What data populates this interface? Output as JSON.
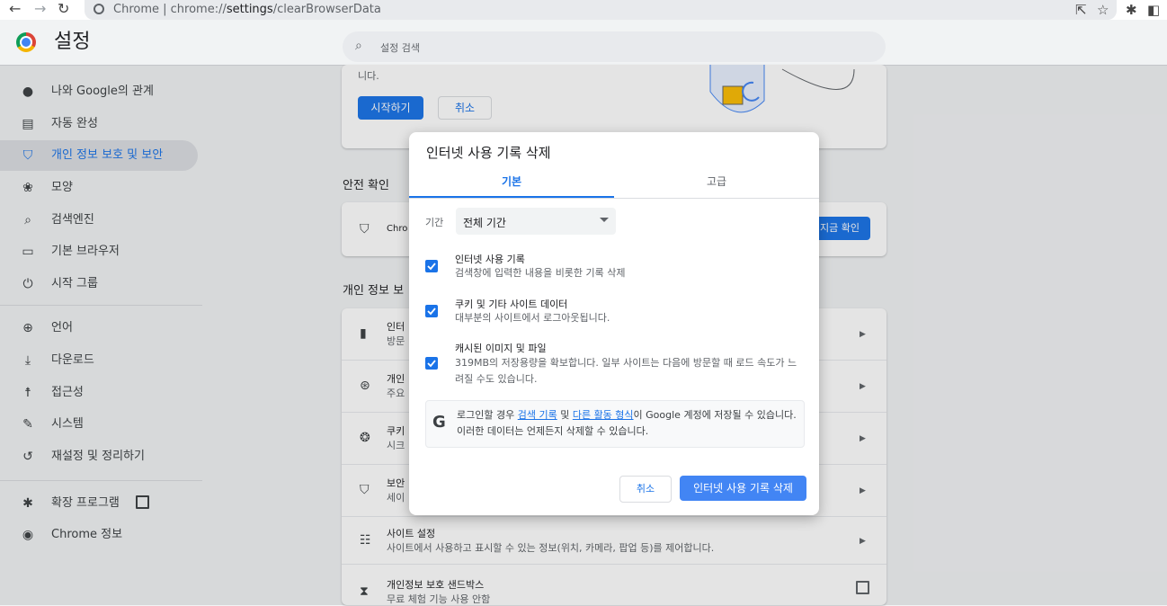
{
  "browser": {
    "site_label": "Chrome",
    "url_prefix": "chrome://",
    "url_main": "settings",
    "url_rest": "/clearBrowserData"
  },
  "header": {
    "title": "설정",
    "search_placeholder": "설정 검색"
  },
  "sidebar": {
    "items": [
      {
        "label": "나와 Google의 관계",
        "icon": "person-icon"
      },
      {
        "label": "자동 완성",
        "icon": "clipboard-icon"
      },
      {
        "label": "개인 정보 보호 및 보안",
        "icon": "shield-icon",
        "active": true
      },
      {
        "label": "모양",
        "icon": "palette-icon"
      },
      {
        "label": "검색엔진",
        "icon": "search-icon"
      },
      {
        "label": "기본 브라우저",
        "icon": "browser-icon"
      },
      {
        "label": "시작 그룹",
        "icon": "power-icon"
      },
      {
        "label": "언어",
        "icon": "globe-icon"
      },
      {
        "label": "다운로드",
        "icon": "download-icon"
      },
      {
        "label": "접근성",
        "icon": "accessibility-icon"
      },
      {
        "label": "시스템",
        "icon": "wrench-icon"
      },
      {
        "label": "재설정 및 정리하기",
        "icon": "restore-icon"
      },
      {
        "label": "확장 프로그램",
        "icon": "puzzle-icon"
      },
      {
        "label": "Chrome 정보",
        "icon": "chrome-icon"
      }
    ]
  },
  "main": {
    "top_card_fragment": "니다.",
    "start_btn": "시작하기",
    "cancel_btn": "취소",
    "safety_title": "안전 확인",
    "safety_text": "Chro",
    "safety_btn": "지금 확인",
    "privacy_title": "개인 정보 보",
    "rows": [
      {
        "t1": "인터",
        "t2": "방문"
      },
      {
        "t1": "개인",
        "t2": "주요"
      },
      {
        "t1": "쿠키",
        "t2": "시크"
      },
      {
        "t1": "보안",
        "t2": "세이"
      },
      {
        "t1": "사이트 설정",
        "t2": "사이트에서 사용하고 표시할 수 있는 정보(위치, 카메라, 팝업 등)를 제어합니다."
      },
      {
        "t1": "개인정보 보호 샌드박스",
        "t2": "무료 체험 기능 사용 안함"
      }
    ]
  },
  "dialog": {
    "title": "인터넷 사용 기록 삭제",
    "tab_basic": "기본",
    "tab_advanced": "고급",
    "range_label": "기간",
    "range_value": "전체 기간",
    "options": [
      {
        "title": "인터넷 사용 기록",
        "sub": "검색창에 입력한 내용을 비롯한 기록 삭제",
        "checked": true
      },
      {
        "title": "쿠키 및 기타 사이트 데이터",
        "sub": "대부분의 사이트에서 로그아웃됩니다.",
        "checked": true
      },
      {
        "title": "캐시된 이미지 및 파일",
        "sub": "319MB의 저장용량을 확보합니다. 일부 사이트는 다음에 방문할 때 로드 속도가 느려질 수도 있습니다.",
        "checked": true
      }
    ],
    "google_note": {
      "pre": "로그인할 경우 ",
      "link1": "검색 기록",
      "mid": " 및 ",
      "link2": "다른 활동 형식",
      "post": "이 Google 계정에 저장될 수 있습니다. 이러한 데이터는 언제든지 삭제할 수 있습니다."
    },
    "cancel": "취소",
    "confirm": "인터넷 사용 기록 삭제"
  },
  "colors": {
    "accent": "#1a73e8",
    "confirm_button": "#4285f4"
  }
}
